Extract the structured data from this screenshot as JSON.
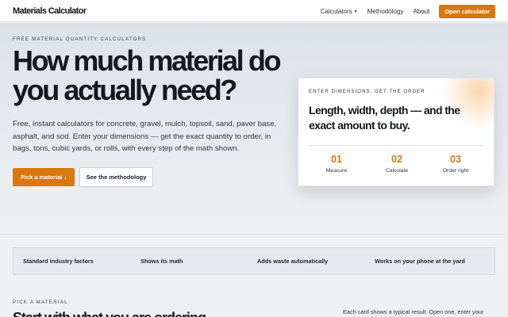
{
  "nav": {
    "brand": "Materials Calculator",
    "links": [
      {
        "label": "Calculators",
        "has_dropdown": true
      },
      {
        "label": "Methodology"
      },
      {
        "label": "About"
      }
    ],
    "cta": "Open calculator"
  },
  "hero": {
    "eyebrow": "FREE MATERIAL QUANTITY CALCULATORS",
    "title": "How much material do you actually need?",
    "subtitle": "Free, instant calculators for concrete, gravel, mulch, topsoil, sand, paver base, asphalt, and sod. Enter your dimensions — get the exact quantity to order, in bags, tons, cubic yards, or rolls, with every step of the math shown.",
    "primary_button": "Pick a material ↓",
    "secondary_button": "See the methodology"
  },
  "card": {
    "eyebrow": "ENTER DIMENSIONS, GET THE ORDER",
    "title": "Length, width, depth — and the exact amount to buy.",
    "steps": [
      {
        "num": "01",
        "label": "Measure"
      },
      {
        "num": "02",
        "label": "Calculate"
      },
      {
        "num": "03",
        "label": "Order right"
      }
    ]
  },
  "features": [
    "Standard industry factors",
    "Shows its math",
    "Adds waste automatically",
    "Works on your phone at the yard"
  ],
  "section": {
    "eyebrow": "PICK A MATERIAL",
    "title": "Start with what you are ordering",
    "note": "Each card shows a typical result. Open one, enter your"
  },
  "colors": {
    "accent": "#d9780f",
    "text": "#15181d",
    "background": "#eef0f3"
  }
}
